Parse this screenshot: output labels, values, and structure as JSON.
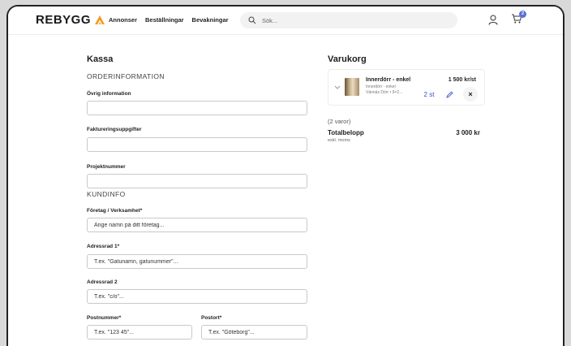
{
  "header": {
    "logo_text": "REBYGG",
    "nav": [
      "Annonser",
      "Beställningar",
      "Bevakningar"
    ],
    "search_placeholder": "Sök...",
    "cart_count": "2"
  },
  "checkout": {
    "title": "Kassa",
    "order_section": "ORDERINFORMATION",
    "other_info_label": "Övrig information",
    "billing_label": "Faktureringsuppgifter",
    "project_label": "Projektnummer",
    "customer_section": "KUNDINFO",
    "company_label": "Företag / Verksamhet*",
    "company_placeholder": "Ange namn på ditt företag...",
    "address1_label": "Adressrad 1*",
    "address1_placeholder": "T.ex. \"Gatunamn, gatunummer\"...",
    "address2_label": "Adressrad 2",
    "address2_placeholder": "T.ex. \"c/o\"...",
    "postal_label": "Postnummer*",
    "postal_placeholder": "T.ex. \"123 45\"...",
    "city_label": "Postort*",
    "city_placeholder": "T.ex. \"Göteborg\"..."
  },
  "cart": {
    "title": "Varukorg",
    "item": {
      "name": "Innerdörr - enkel",
      "price": "1 500 kr/st",
      "sub1": "Innerdörr - enkel",
      "sub2": "Vännäs Dörr • 9×2...",
      "qty": "2 st"
    },
    "count_text": "(2 varor)",
    "total_label": "Totalbelopp",
    "total_value": "3 000 kr",
    "vat_note": "exkl. moms"
  },
  "colors": {
    "accent": "#f39a1e",
    "link_blue": "#3a4fc8",
    "badge": "#5b6fd8"
  }
}
